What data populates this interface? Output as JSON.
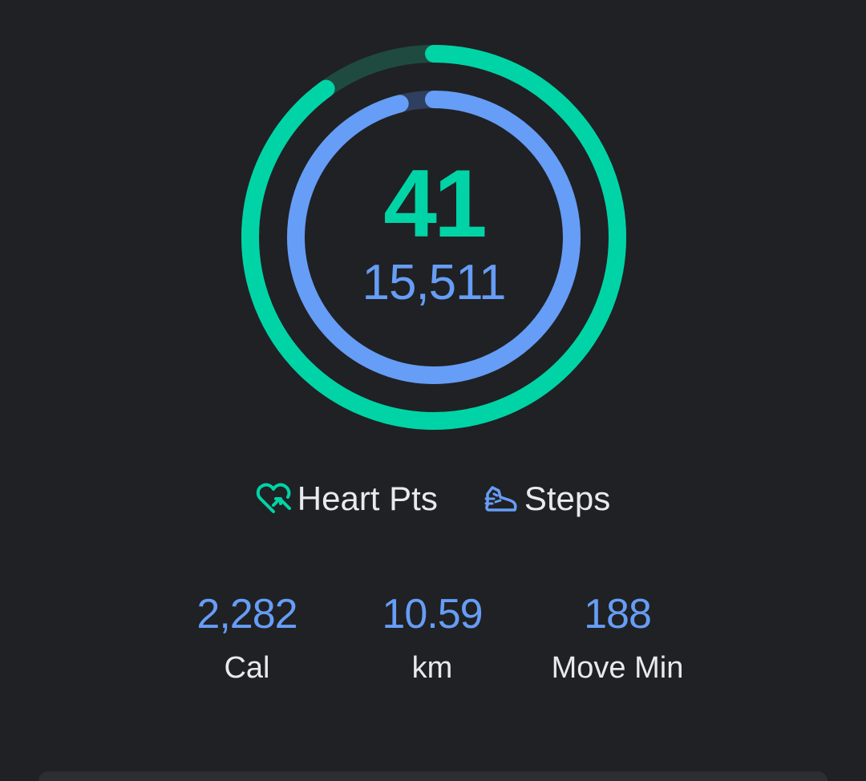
{
  "colors": {
    "heart": "#00d4a6",
    "steps": "#669df6",
    "background": "#202124",
    "text": "#e8eaed"
  },
  "goals": {
    "heart_points": {
      "value": "41",
      "progress": 0.9
    },
    "steps": {
      "value": "15,511",
      "progress": 0.96
    }
  },
  "legend": {
    "heart_label": "Heart Pts",
    "heart_icon": "heart-arrow-icon",
    "steps_label": "Steps",
    "steps_icon": "shoe-icon"
  },
  "stats": [
    {
      "value": "2,282",
      "label": "Cal"
    },
    {
      "value": "10.59",
      "label": "km"
    },
    {
      "value": "188",
      "label": "Move Min"
    }
  ]
}
